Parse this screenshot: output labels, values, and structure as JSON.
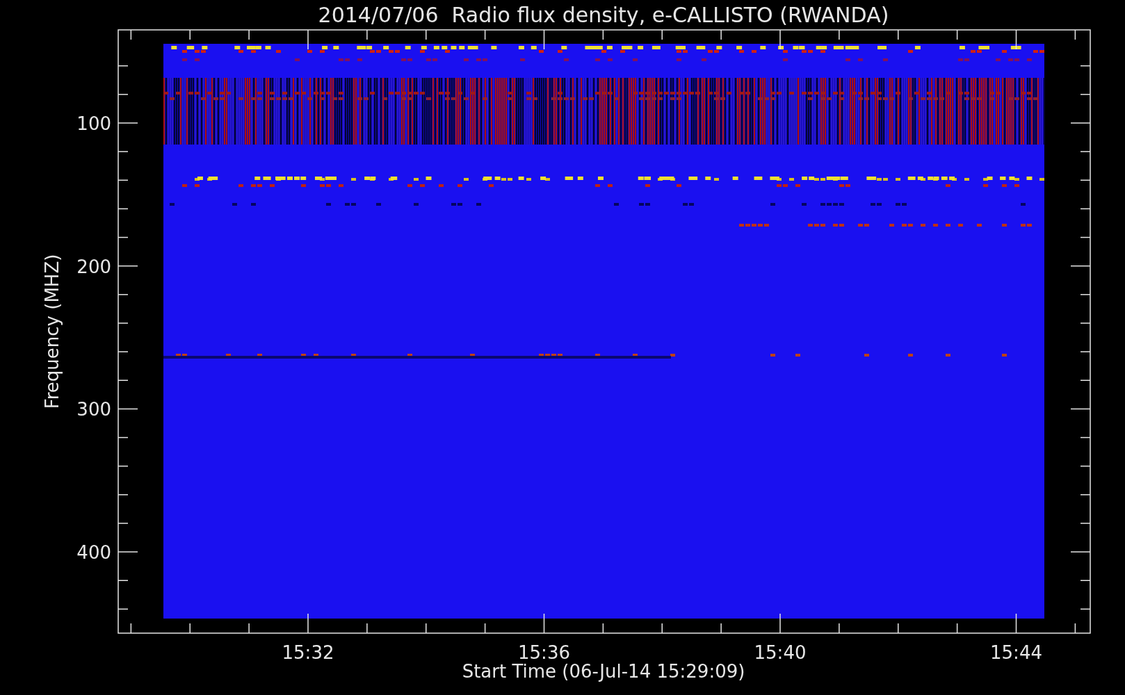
{
  "title": "2014/07/06  Radio flux density, e-CALLISTO (RWANDA)",
  "y_axis": {
    "label": "Frequency (MHZ)",
    "ticks": [
      "100",
      "200",
      "300",
      "400"
    ]
  },
  "x_axis": {
    "label": "Start Time (06-Jul-14 15:29:09)",
    "ticks": [
      "15:32",
      "15:36",
      "15:40",
      "15:44"
    ]
  }
}
